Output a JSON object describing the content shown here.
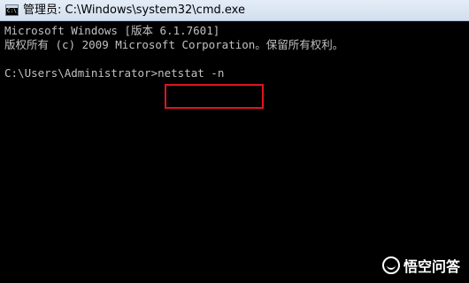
{
  "window": {
    "title": "管理员: C:\\Windows\\system32\\cmd.exe",
    "icon_name": "cmd-icon",
    "icon_text": "C:\\"
  },
  "console": {
    "line1": "Microsoft Windows [版本 6.1.7601]",
    "line2": "版权所有 (c) 2009 Microsoft Corporation。保留所有权利。",
    "prompt": "C:\\Users\\Administrator>",
    "command": "netstat -n"
  },
  "highlight": {
    "color": "#e0141e"
  },
  "watermark": {
    "text": "悟空问答"
  }
}
